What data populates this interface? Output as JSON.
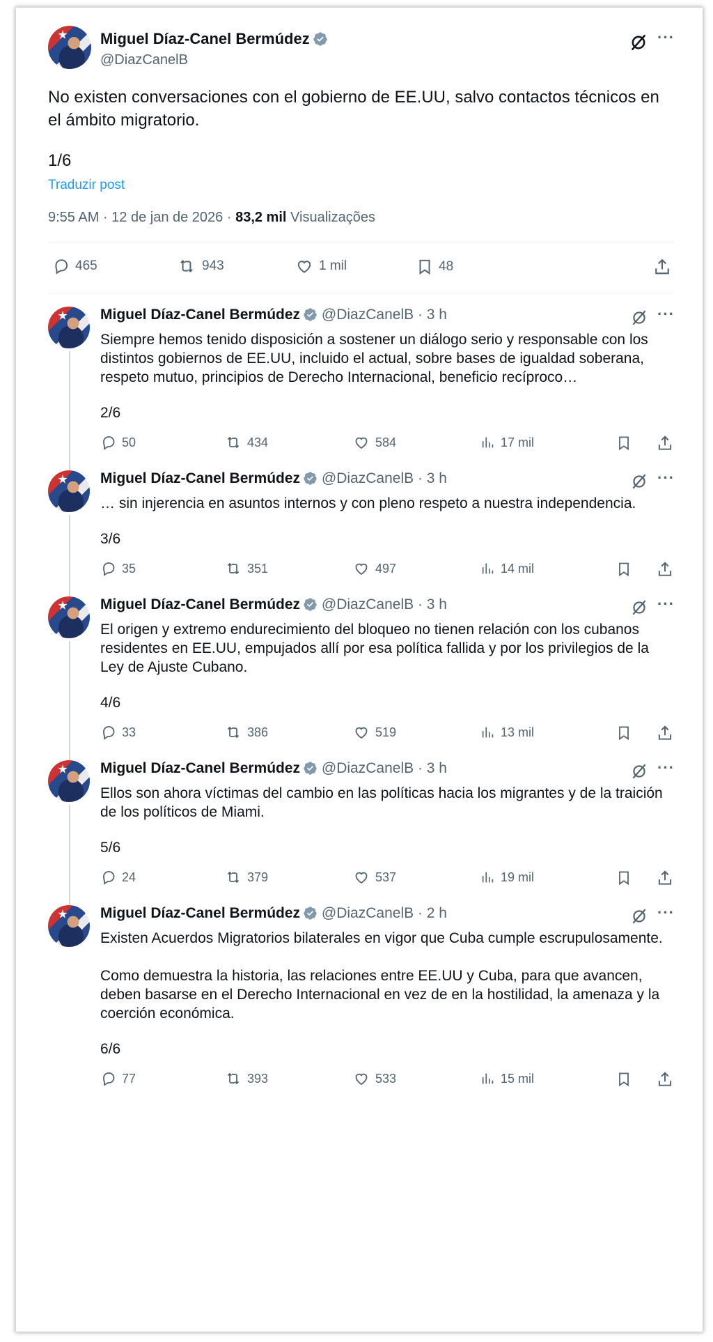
{
  "main": {
    "author_name": "Miguel Díaz-Canel Bermúdez",
    "author_handle": "@DiazCanelB",
    "text": "No existen conversaciones con el gobierno de EE.UU, salvo contactos técnicos en el ámbito migratorio.",
    "counter": "1/6",
    "translate": "Traduzir post",
    "time": "9:55 AM · 12 de jan de 2026 · ",
    "views_value": "83,2 mil",
    "views_label": "Visualizações",
    "replies": "465",
    "reposts": "943",
    "likes": "1 mil",
    "bookmarks": "48"
  },
  "replies": [
    {
      "name": "Miguel Díaz-Canel Bermúdez",
      "handle": "@DiazCanelB · 3 h",
      "text": "Siempre hemos tenido disposición a sostener un diálogo serio y responsable con los distintos gobiernos de EE.UU,  incluido el actual, sobre bases de igualdad soberana,  respeto mutuo, principios de Derecho Internacional, beneficio recíproco…",
      "counter": "2/6",
      "replies": "50",
      "reposts": "434",
      "likes": "584",
      "views": "17 mil"
    },
    {
      "name": "Miguel Díaz-Canel Bermúdez",
      "handle": "@DiazCanelB · 3 h",
      "text": "… sin injerencia en asuntos internos y con pleno respeto a nuestra independencia.",
      "counter": "3/6",
      "replies": "35",
      "reposts": "351",
      "likes": "497",
      "views": "14 mil"
    },
    {
      "name": "Miguel Díaz-Canel Bermúdez",
      "handle": "@DiazCanelB · 3 h",
      "text": "El origen y extremo endurecimiento del bloqueo no tienen relación con los cubanos residentes en EE.UU, empujados allí por esa política fallida y por los privilegios de la Ley de Ajuste Cubano.",
      "counter": "4/6",
      "replies": "33",
      "reposts": "386",
      "likes": "519",
      "views": "13 mil"
    },
    {
      "name": "Miguel Díaz-Canel Bermúdez",
      "handle": "@DiazCanelB · 3 h",
      "text": "Ellos son ahora víctimas del cambio en las políticas hacia los migrantes y de la traición de los políticos de Miami.",
      "counter": "5/6",
      "replies": "24",
      "reposts": "379",
      "likes": "537",
      "views": "19 mil"
    },
    {
      "name": "Miguel Díaz-Canel Bermúdez",
      "handle": "@DiazCanelB · 2 h",
      "text": "Existen Acuerdos Migratorios bilaterales en vigor que Cuba cumple escrupulosamente.\n\nComo demuestra la historia, las relaciones entre EE.UU y Cuba, para que avancen, deben basarse en el Derecho Internacional en vez de en la hostilidad, la amenaza y la coerción económica.",
      "counter": "6/6",
      "replies": "77",
      "reposts": "393",
      "likes": "533",
      "views": "15 mil"
    }
  ],
  "colors": {
    "accent": "#1d9bf0",
    "muted": "#536471",
    "text": "#0f1419"
  }
}
